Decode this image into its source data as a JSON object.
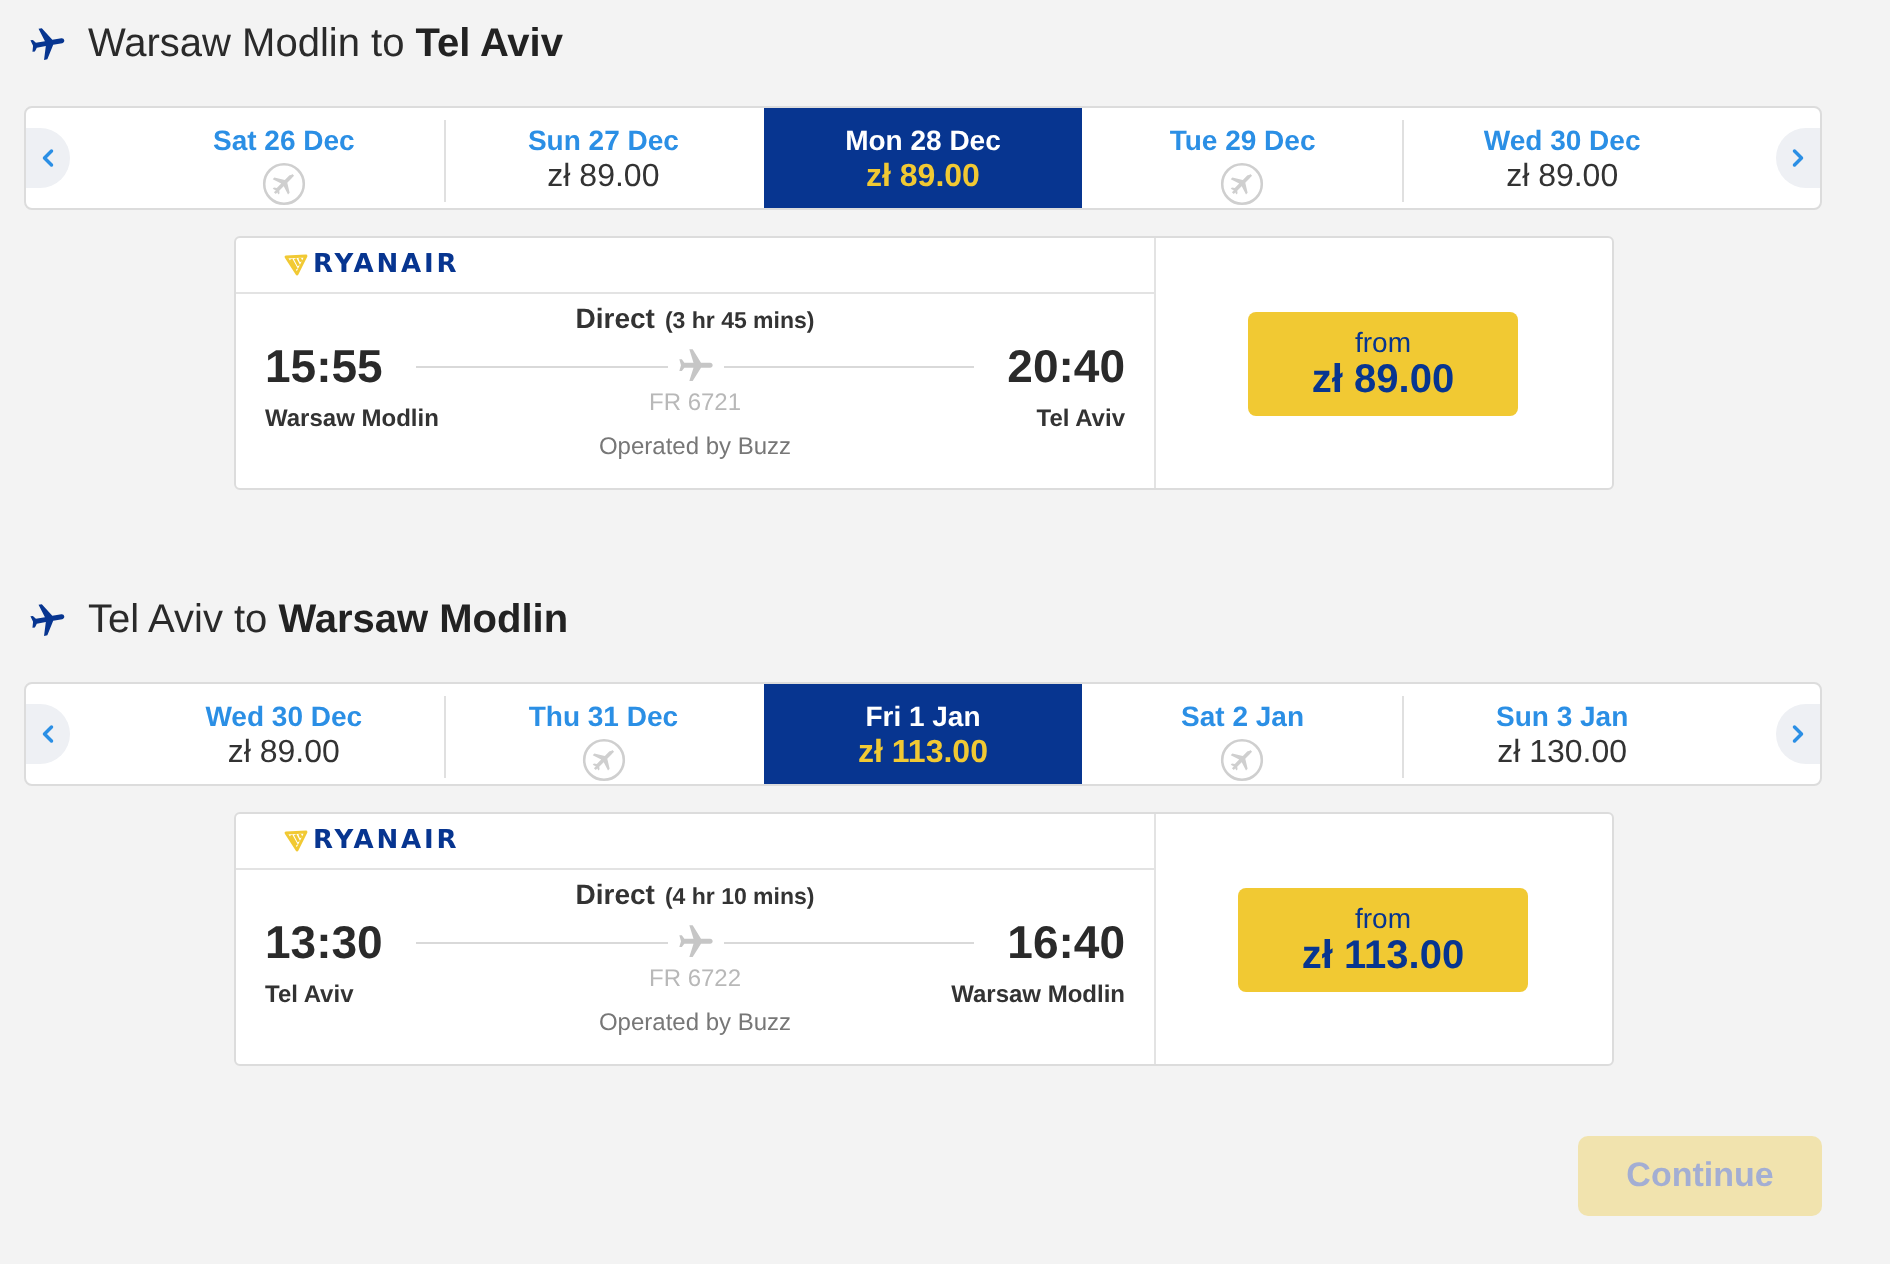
{
  "legs": [
    {
      "title": "Warsaw Modlin to **Tel Aviv**",
      "dates": [
        {
          "date": "Sat 26 Dec",
          "kind": "no_flight",
          "selected": false
        },
        {
          "date": "Sun 27 Dec",
          "kind": "fare",
          "price": "zł 89.00",
          "selected": false
        },
        {
          "date": "Mon 28 Dec",
          "kind": "fare",
          "price": "zł 89.00",
          "selected": true
        },
        {
          "date": "Tue 29 Dec",
          "kind": "no_flight",
          "selected": false
        },
        {
          "date": "Wed 30 Dec",
          "kind": "fare",
          "price": "zł 89.00",
          "selected": false
        }
      ],
      "flight": {
        "airline": "RYANAIR",
        "service": "Direct",
        "duration": "(3 hr 45 mins)",
        "departure_time": "15:55",
        "arrival_time": "20:40",
        "origin": "Warsaw Modlin",
        "destination": "Tel Aviv",
        "flight_number": "FR 6721",
        "operator": "Operated by Buzz",
        "fare_label": "from",
        "fare": "zł 89.00"
      }
    },
    {
      "title": "Tel Aviv to **Warsaw Modlin**",
      "dates": [
        {
          "date": "Wed 30 Dec",
          "kind": "fare",
          "price": "zł 89.00",
          "selected": false
        },
        {
          "date": "Thu 31 Dec",
          "kind": "no_flight",
          "selected": false
        },
        {
          "date": "Fri 1 Jan",
          "kind": "fare",
          "price": "zł 113.00",
          "selected": true
        },
        {
          "date": "Sat 2 Jan",
          "kind": "no_flight",
          "selected": false
        },
        {
          "date": "Sun 3 Jan",
          "kind": "fare",
          "price": "zł 130.00",
          "selected": false
        }
      ],
      "flight": {
        "airline": "RYANAIR",
        "service": "Direct",
        "duration": "(4 hr 10 mins)",
        "departure_time": "13:30",
        "arrival_time": "16:40",
        "origin": "Tel Aviv",
        "destination": "Warsaw Modlin",
        "flight_number": "FR 6722",
        "operator": "Operated by Buzz",
        "fare_label": "from",
        "fare": "zł 113.00"
      }
    }
  ],
  "continue_button": {
    "label": "Continue",
    "disabled": true
  }
}
